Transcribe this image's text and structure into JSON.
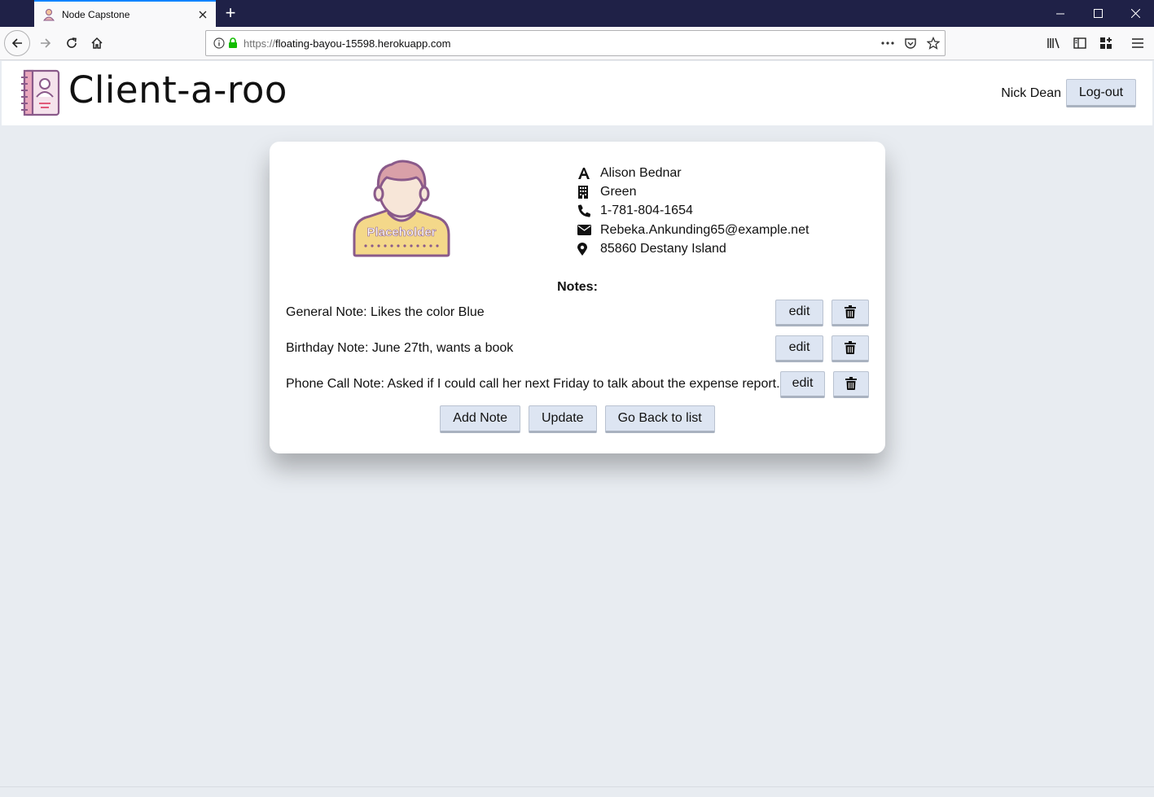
{
  "browser": {
    "tab_title": "Node Capstone",
    "url_prefix": "https://",
    "url_host": "floating-bayou-15598.herokuapp.com",
    "new_tab_label": "+"
  },
  "app": {
    "brand": "Client-a-roo",
    "user_name": "Nick Dean",
    "logout_label": "Log-out"
  },
  "client": {
    "avatar_label": "Placeholder",
    "name": "Alison Bednar",
    "company": "Green",
    "phone": "1-781-804-1654",
    "email": "Rebeka.Ankunding65@example.net",
    "address": "85860 Destany Island",
    "icons": [
      "user-icon",
      "building-icon",
      "phone-icon",
      "envelope-icon",
      "map-marker-icon"
    ]
  },
  "notes": {
    "title": "Notes:",
    "edit_label": "edit",
    "items": [
      {
        "text": "General Note: Likes the color Blue"
      },
      {
        "text": "Birthday Note: June 27th, wants a book"
      },
      {
        "text": "Phone Call Note: Asked if I could call her next Friday to talk about the expense report."
      }
    ]
  },
  "actions": {
    "add_note": "Add Note",
    "update": "Update",
    "back": "Go Back to list"
  },
  "colors": {
    "titlebar": "#1f2147",
    "button_bg": "#dde5f2",
    "page_bg": "#e8ecf1"
  }
}
